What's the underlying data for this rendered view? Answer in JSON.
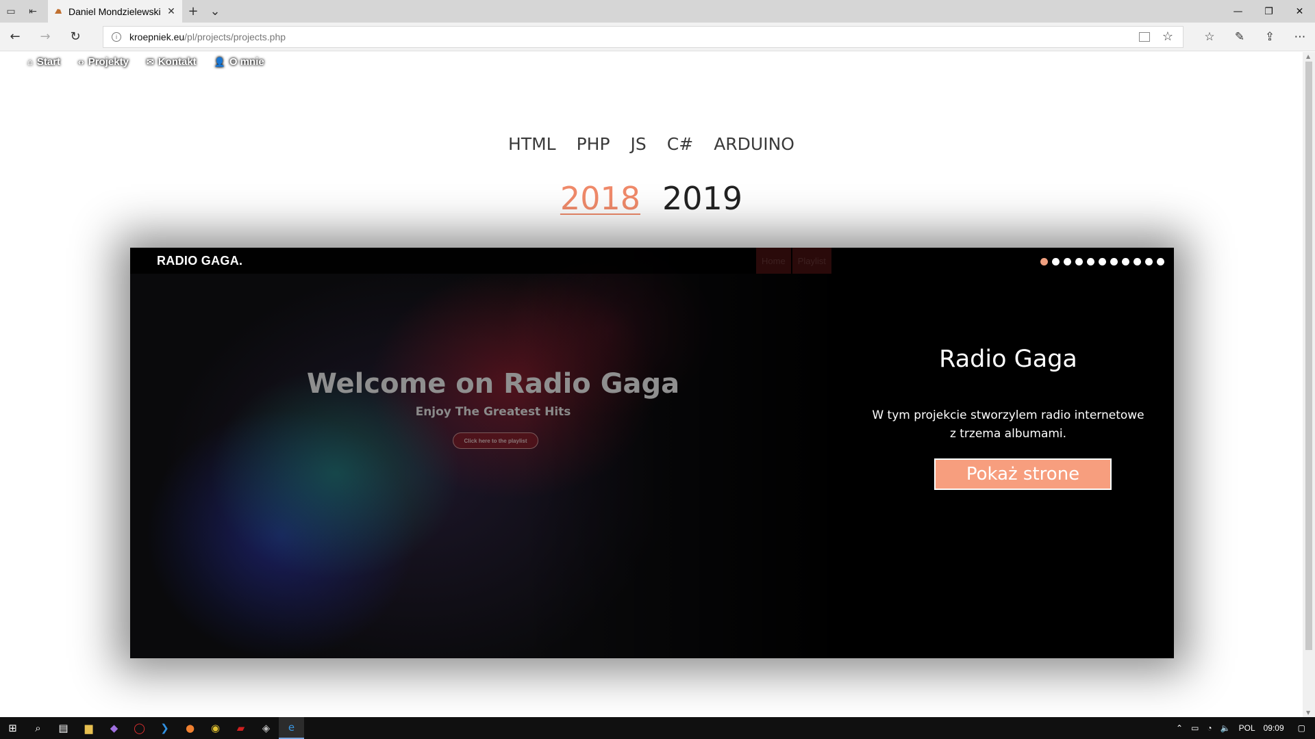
{
  "browser": {
    "tab_title": "Daniel Mondzielewski -",
    "url_host": "kroepniek.eu",
    "url_path": "/pl/projects/projects.php",
    "window_controls": [
      "minimize-icon",
      "restore-icon",
      "close-icon"
    ]
  },
  "site_nav": {
    "items": [
      {
        "label": "Start",
        "icon": "home-icon"
      },
      {
        "label": "Projekty",
        "icon": "code-icon"
      },
      {
        "label": "Kontakt",
        "icon": "envelope-icon"
      },
      {
        "label": "O mnie",
        "icon": "user-icon"
      }
    ]
  },
  "categories": [
    "HTML",
    "PHP",
    "JS",
    "C#",
    "ARDUINO"
  ],
  "years": {
    "active": "2018",
    "other": "2019",
    "active_color": "#f08a6a"
  },
  "preview": {
    "logo": "RADIO GAGA.",
    "menu": [
      "Home",
      "Playlist"
    ],
    "title": "Welcome on Radio Gaga",
    "subtitle": "Enjoy The Greatest Hits",
    "button": "Click here to the playlist"
  },
  "slider": {
    "dot_count": 11,
    "active_dot": 0,
    "active_dot_color": "#f0a080"
  },
  "project": {
    "title": "Radio Gaga",
    "description": "W tym projekcie stworzylem radio internetowe z trzema albumami.",
    "button": "Pokaż strone",
    "button_color": "#f79e7e"
  },
  "taskbar": {
    "language": "POL",
    "time": "09:09"
  }
}
